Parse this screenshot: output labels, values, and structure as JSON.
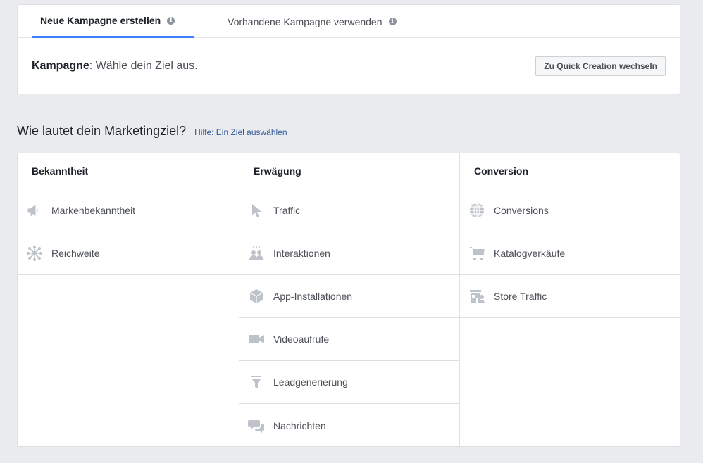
{
  "tabs": {
    "new_label": "Neue Kampagne erstellen",
    "existing_label": "Vorhandene Kampagne verwenden",
    "info_glyph": "i"
  },
  "campaign": {
    "label": "Kampagne",
    "text": ": Wähle dein Ziel aus.",
    "quick_button": "Zu Quick Creation wechseln"
  },
  "objective": {
    "question": "Wie lautet dein Marketingziel?",
    "help": "Hilfe: Ein Ziel auswählen"
  },
  "columns": [
    {
      "header": "Bekanntheit",
      "items": [
        {
          "label": "Markenbekanntheit",
          "icon": "megaphone-icon"
        },
        {
          "label": "Reichweite",
          "icon": "reach-icon"
        }
      ]
    },
    {
      "header": "Erwägung",
      "items": [
        {
          "label": "Traffic",
          "icon": "cursor-icon"
        },
        {
          "label": "Interaktionen",
          "icon": "people-icon"
        },
        {
          "label": "App-Installationen",
          "icon": "box-icon"
        },
        {
          "label": "Videoaufrufe",
          "icon": "video-camera-icon"
        },
        {
          "label": "Leadgenerierung",
          "icon": "funnel-icon"
        },
        {
          "label": "Nachrichten",
          "icon": "chat-bubbles-icon"
        }
      ]
    },
    {
      "header": "Conversion",
      "items": [
        {
          "label": "Conversions",
          "icon": "globe-icon"
        },
        {
          "label": "Katalogverkäufe",
          "icon": "cart-icon"
        },
        {
          "label": "Store Traffic",
          "icon": "store-icon"
        }
      ]
    }
  ],
  "colors": {
    "accent": "#4080ff",
    "icon": "#bec3c9",
    "link": "#365899"
  }
}
